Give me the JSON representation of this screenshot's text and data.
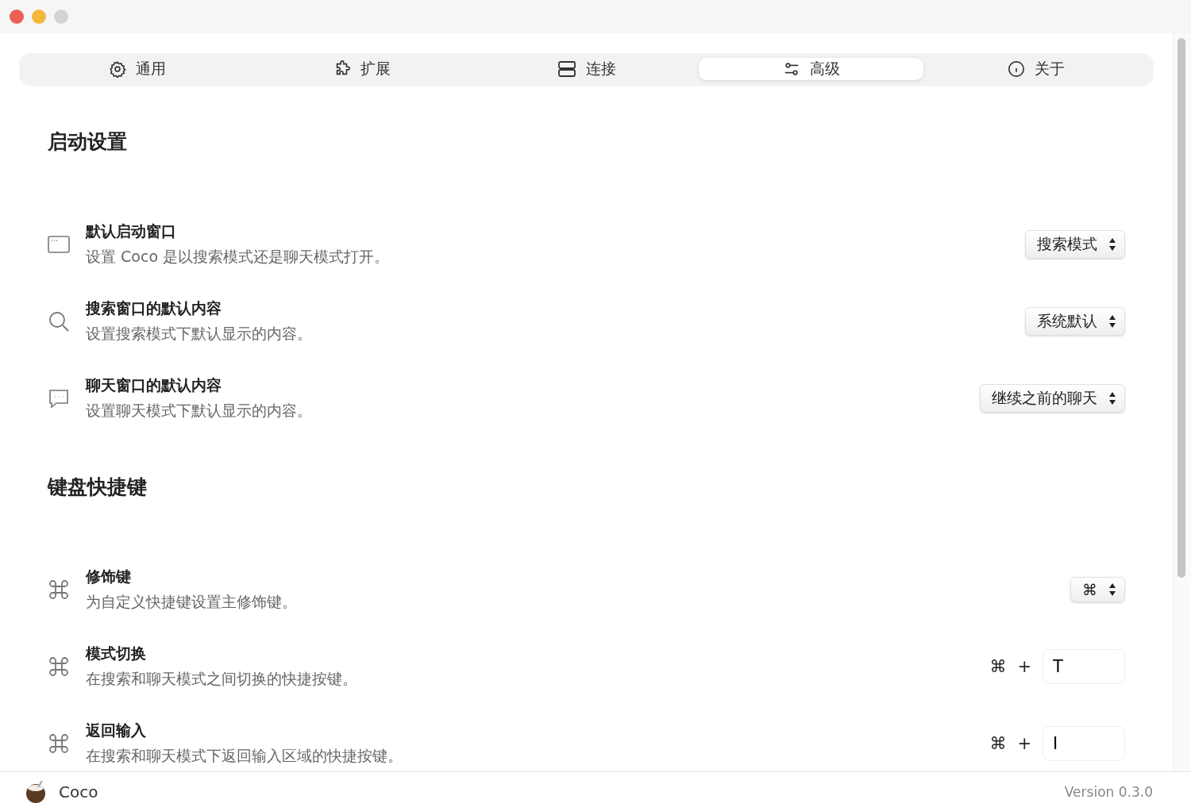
{
  "tabs": [
    {
      "label": "通用",
      "selected": false
    },
    {
      "label": "扩展",
      "selected": false
    },
    {
      "label": "连接",
      "selected": false
    },
    {
      "label": "高级",
      "selected": true
    },
    {
      "label": "关于",
      "selected": false
    }
  ],
  "sections": [
    {
      "title": "启动设置",
      "rows": [
        {
          "kind": "select",
          "title": "默认启动窗口",
          "description": "设置 Coco 是以搜索模式还是聊天模式打开。",
          "value": "搜索模式"
        },
        {
          "kind": "select",
          "title": "搜索窗口的默认内容",
          "description": "设置搜索模式下默认显示的内容。",
          "value": "系统默认"
        },
        {
          "kind": "select",
          "title": "聊天窗口的默认内容",
          "description": "设置聊天模式下默认显示的内容。",
          "value": "继续之前的聊天"
        }
      ]
    },
    {
      "title": "键盘快捷键",
      "rows": [
        {
          "kind": "select",
          "title": "修饰键",
          "description": "为自定义快捷键设置主修饰键。",
          "value": "⌘"
        },
        {
          "kind": "shortcut",
          "title": "模式切换",
          "description": "在搜索和聊天模式之间切换的快捷按键。",
          "modifier": "⌘",
          "plus": "+",
          "value": "T"
        },
        {
          "kind": "shortcut",
          "title": "返回输入",
          "description": "在搜索和聊天模式下返回输入区域的快捷按键。",
          "modifier": "⌘",
          "plus": "+",
          "value": "I"
        }
      ]
    }
  ],
  "footer": {
    "app_name": "Coco",
    "version": "Version 0.3.0"
  }
}
